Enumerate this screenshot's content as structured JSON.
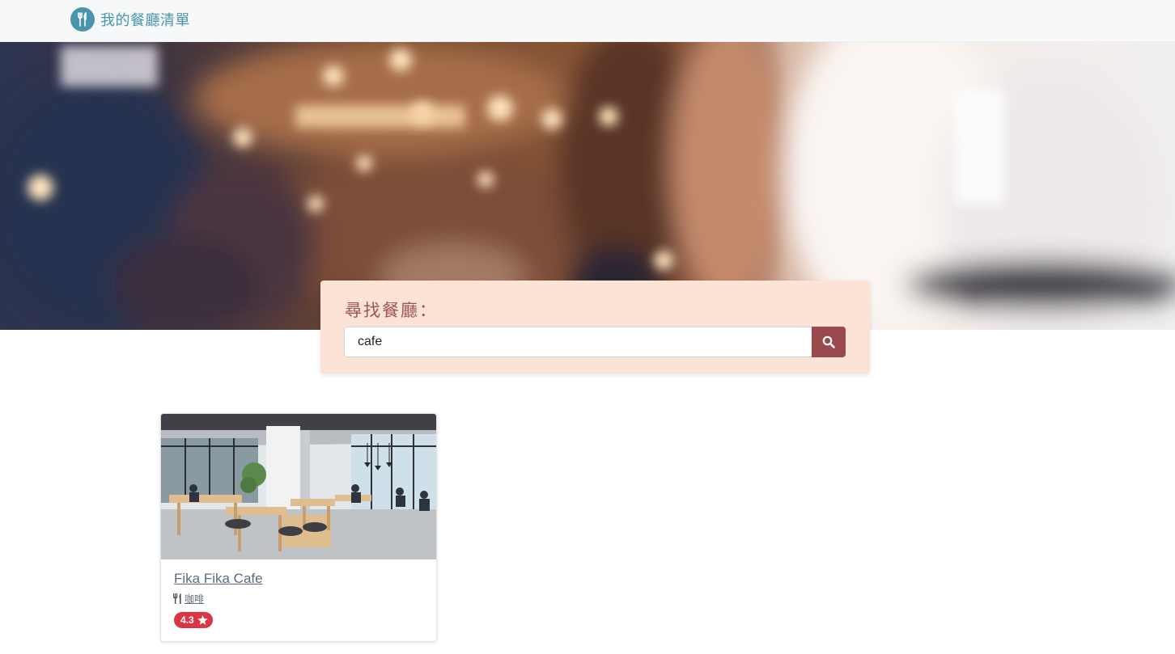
{
  "navbar": {
    "brand_title": "我的餐廳清單",
    "brand_icon": "utensils-icon",
    "brand_color": "#4a95ad"
  },
  "hero": {
    "image": "blurred-cafe-interior"
  },
  "search": {
    "title": "尋找餐廳：",
    "input_value": "cafe",
    "button_icon": "search-icon",
    "panel_color": "#fde3d6",
    "button_color": "#9a4a4d"
  },
  "restaurants": [
    {
      "name": "Fika Fika Cafe",
      "category": "咖啡",
      "category_icon": "utensils-icon",
      "rating": "4.3",
      "rating_icon": "star-icon",
      "rating_color": "#dc3545",
      "image": "cafe-interior-photo"
    }
  ]
}
